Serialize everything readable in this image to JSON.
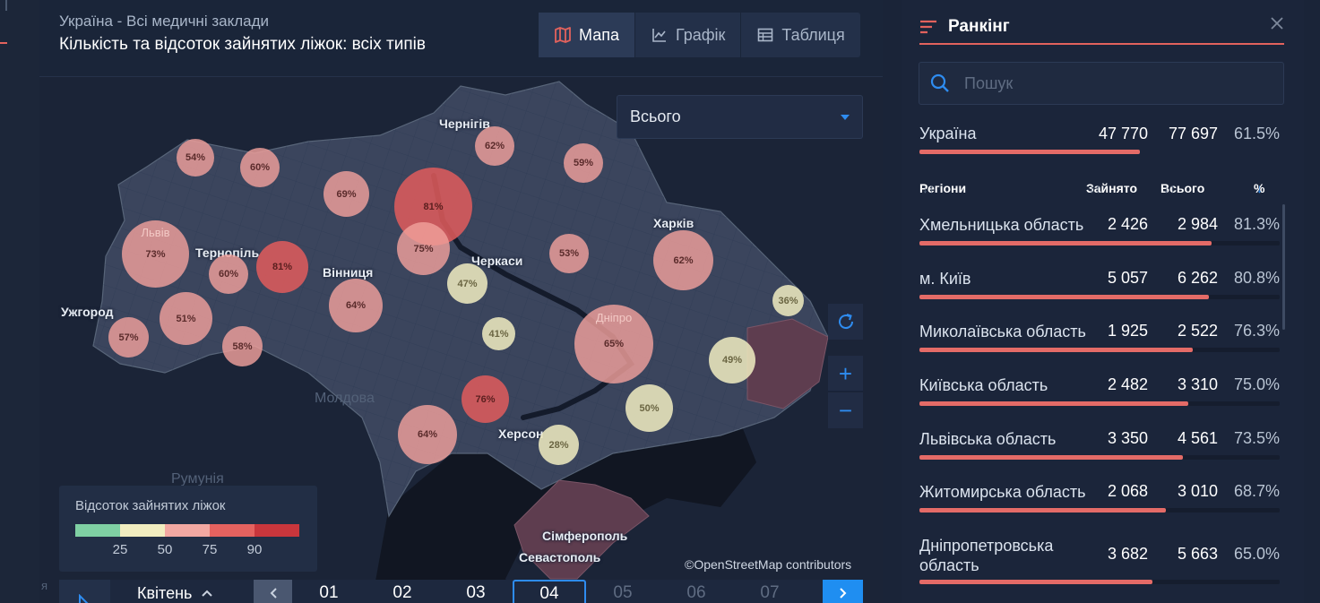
{
  "header": {
    "subtitle": "Україна - Всі медичні заклади",
    "title": "Кількість та відсоток зайнятих ліжок: всіх типів",
    "tabs": [
      {
        "label": "Мапа",
        "icon": "map-icon",
        "active": true
      },
      {
        "label": "Графік",
        "icon": "line-chart-icon",
        "active": false
      },
      {
        "label": "Таблиця",
        "icon": "table-icon",
        "active": false
      }
    ]
  },
  "map": {
    "dropdown": {
      "selected": "Всього"
    },
    "cities": [
      "Чернігів",
      "Харків",
      "Тернопіль",
      "Черкаси",
      "Вінниця",
      "Ужгород",
      "Херсон",
      "Сімферополь",
      "Севастополь"
    ],
    "countries": [
      "Молдова",
      "Румунія"
    ],
    "bubble_labels": [
      "Львів",
      "Дніпро"
    ],
    "bubbles": [
      "54%",
      "60%",
      "69%",
      "62%",
      "59%",
      "81%",
      "73%",
      "60%",
      "81%",
      "75%",
      "53%",
      "62%",
      "47%",
      "36%",
      "64%",
      "51%",
      "41%",
      "65%",
      "57%",
      "58%",
      "49%",
      "76%",
      "50%",
      "64%",
      "28%"
    ],
    "attribution": "©OpenStreetMap contributors",
    "controls": {
      "refresh_icon": "refresh-icon",
      "zoom_in": "+",
      "zoom_out": "−"
    },
    "edge_letter": "я"
  },
  "legend": {
    "title": "Відсоток зайнятих ліжок",
    "colors": [
      "#7fd0a3",
      "#f1edc0",
      "#f2a8a2",
      "#e5625f",
      "#c9363c"
    ],
    "ticks": [
      "25",
      "50",
      "75",
      "90"
    ]
  },
  "timeline": {
    "month": "Квітень",
    "days": [
      "01",
      "02",
      "03",
      "04",
      "05",
      "06",
      "07"
    ],
    "active_day": "04"
  },
  "ranking": {
    "title": "Ранкінг",
    "search_placeholder": "Пошук",
    "total": {
      "name": "Україна",
      "occupied": "47 770",
      "total": "77 697",
      "percent": "61.5%",
      "fraction": 0.615
    },
    "columns": {
      "region": "Регіони",
      "occupied": "Зайнято",
      "total": "Всього",
      "percent": "%"
    },
    "rows": [
      {
        "name": "Хмельницька область",
        "occupied": "2 426",
        "total": "2 984",
        "percent": "81.3%",
        "fraction": 0.813
      },
      {
        "name": "м. Київ",
        "occupied": "5 057",
        "total": "6 262",
        "percent": "80.8%",
        "fraction": 0.808
      },
      {
        "name": "Миколаївська область",
        "occupied": "1 925",
        "total": "2 522",
        "percent": "76.3%",
        "fraction": 0.763
      },
      {
        "name": "Київська область",
        "occupied": "2 482",
        "total": "3 310",
        "percent": "75.0%",
        "fraction": 0.75
      },
      {
        "name": "Львівська область",
        "occupied": "3 350",
        "total": "4 561",
        "percent": "73.5%",
        "fraction": 0.735
      },
      {
        "name": "Житомирська область",
        "occupied": "2 068",
        "total": "3 010",
        "percent": "68.7%",
        "fraction": 0.687
      },
      {
        "name": "Дніпропетровська область",
        "occupied": "3 682",
        "total": "5 663",
        "percent": "65.0%",
        "fraction": 0.65
      }
    ]
  }
}
